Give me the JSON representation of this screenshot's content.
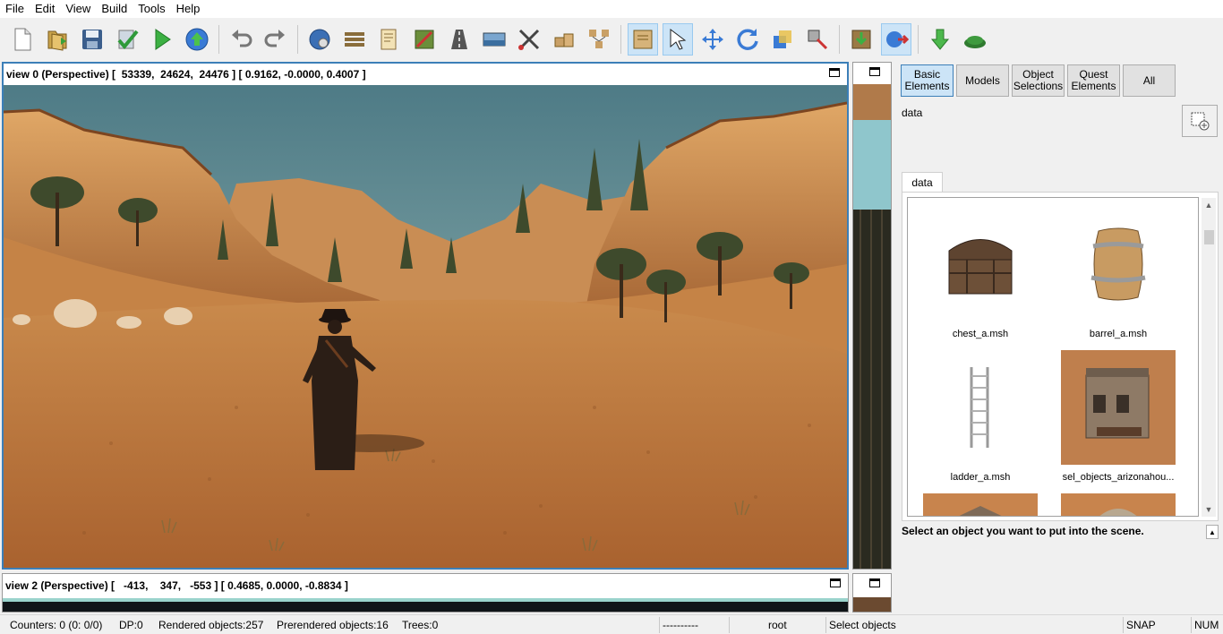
{
  "menu": [
    "File",
    "Edit",
    "View",
    "Build",
    "Tools",
    "Help"
  ],
  "toolbar": [
    {
      "name": "new-file-icon"
    },
    {
      "name": "open-folder-icon"
    },
    {
      "name": "save-icon"
    },
    {
      "name": "check-icon"
    },
    {
      "name": "play-icon"
    },
    {
      "name": "upload-icon"
    },
    {
      "name": "undo-icon"
    },
    {
      "name": "redo-icon"
    },
    {
      "name": "globe-gear-icon"
    },
    {
      "name": "layers-icon"
    },
    {
      "name": "script-icon"
    },
    {
      "name": "terrain-paint-icon"
    },
    {
      "name": "road-icon"
    },
    {
      "name": "water-icon"
    },
    {
      "name": "tools-icon"
    },
    {
      "name": "boxes-icon"
    },
    {
      "name": "group-icon"
    },
    {
      "name": "map-book-icon",
      "active": true
    },
    {
      "name": "select-arrow-icon",
      "active": true
    },
    {
      "name": "move-icon"
    },
    {
      "name": "rotate-icon"
    },
    {
      "name": "scale-icon"
    },
    {
      "name": "transform-icon"
    },
    {
      "name": "import-icon"
    },
    {
      "name": "export-icon",
      "active": true
    },
    {
      "name": "download-arrow-icon"
    },
    {
      "name": "terrain-icon"
    }
  ],
  "view0": {
    "title": "view 0 (Perspective) [  53339,  24624,  24476 ] [ 0.9162, -0.0000, 0.4007 ]"
  },
  "view2": {
    "title": "view 2 (Perspective) [   -413,    347,   -553 ] [ 0.4685, 0.0000, -0.8834 ]"
  },
  "panel": {
    "tabs": [
      {
        "label": "Basic Elements",
        "active": true
      },
      {
        "label": "Models"
      },
      {
        "label": "Object Selections"
      },
      {
        "label": "Quest Elements"
      },
      {
        "label": "All"
      }
    ],
    "path": "data",
    "subtab": "data",
    "assets": [
      {
        "label": "chest_a.msh",
        "icon": "chest-icon"
      },
      {
        "label": "barrel_a.msh",
        "icon": "barrel-icon"
      },
      {
        "label": "ladder_a.msh",
        "icon": "ladder-icon"
      },
      {
        "label": "sel_objects_arizonahou...",
        "icon": "house-icon"
      },
      {
        "label": "",
        "icon": "roof-icon"
      },
      {
        "label": "",
        "icon": "building-icon"
      }
    ],
    "hint": "Select an object you want to put into the scene."
  },
  "status": {
    "counters": "Counters: 0  (0: 0/0)",
    "dp": "DP:0",
    "rendered": "Rendered objects:257",
    "prerendered": "Prerendered objects:16",
    "trees": "Trees:0",
    "dashes": "----------",
    "root": "root",
    "mode": "Select objects",
    "snap": "SNAP",
    "num": "NUM"
  }
}
